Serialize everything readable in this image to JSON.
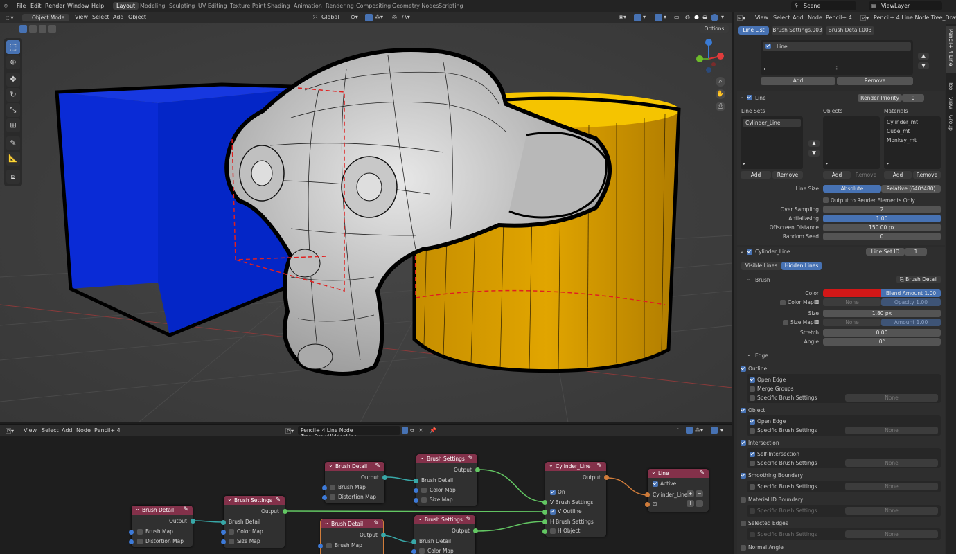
{
  "top_menu": [
    "File",
    "Edit",
    "Render",
    "Window",
    "Help"
  ],
  "workspaces": [
    "Layout",
    "Modeling",
    "Sculpting",
    "UV Editing",
    "Texture Paint",
    "Shading",
    "Animation",
    "Rendering",
    "Compositing",
    "Geometry Nodes",
    "Scripting"
  ],
  "scene": "Scene",
  "view_layer": "ViewLayer",
  "viewport": {
    "mode": "Object Mode",
    "menus": [
      "View",
      "Select",
      "Add",
      "Object"
    ],
    "transform": "Global",
    "options": "Options"
  },
  "node_editor": {
    "menus": [
      "View",
      "Select",
      "Add",
      "Node",
      "Pencil+ 4"
    ],
    "tree_name": "Pencil+ 4 Line Node Tree_DrawHiddenLine",
    "nodes": {
      "bd1": {
        "title": "Brush Detail",
        "out": "Output",
        "rows": [
          "Brush Map",
          "Distortion Map"
        ]
      },
      "bd2": {
        "title": "Brush Detail",
        "out": "Output",
        "rows": [
          "Brush Map",
          "Distortion Map"
        ]
      },
      "bd3": {
        "title": "Brush Detail",
        "out": "Output",
        "rows": [
          "Brush Map"
        ]
      },
      "bs1": {
        "title": "Brush Settings",
        "out": "Output",
        "rows": [
          "Brush Detail",
          "Color Map",
          "Size Map"
        ]
      },
      "bs2": {
        "title": "Brush Settings",
        "out": "Output",
        "rows": [
          "Brush Detail",
          "Color Map",
          "Size Map"
        ]
      },
      "bs3": {
        "title": "Brush Settings",
        "out": "Output",
        "rows": [
          "Brush Detail",
          "Color Map"
        ]
      },
      "cyl": {
        "title": "Cylinder_Line",
        "out": "Output",
        "rows": [
          "On",
          "V Brush Settings",
          "V Outline",
          "H Brush Settings",
          "H Object"
        ]
      },
      "line": {
        "title": "Line",
        "active": "Active",
        "row": "Cylinder_Line"
      }
    }
  },
  "properties": {
    "header_menus": [
      "View",
      "Select",
      "Add",
      "Node",
      "Pencil+ 4"
    ],
    "tree_name": "Pencil+ 4 Line Node Tree_DrawHidd",
    "tabs": [
      "Line List",
      "Brush Settings.003",
      "Brush Detail.003"
    ],
    "line_list_item": "Line",
    "add": "Add",
    "remove": "Remove",
    "line_section": "Line",
    "render_priority_label": "Render Priority",
    "render_priority": "0",
    "line_sets_label": "Line Sets",
    "objects_label": "Objects",
    "materials_label": "Materials",
    "line_set_item": "Cylinder_Line",
    "materials": [
      "Cylinder_mt",
      "Cube_mt",
      "Monkey_mt"
    ],
    "line_size_label": "Line Size",
    "line_size_abs": "Absolute",
    "line_size_rel": "Relative (640*480)",
    "output_render_elements": "Output to Render Elements Only",
    "over_sampling_label": "Over Sampling",
    "over_sampling": "2",
    "antialiasing_label": "Antialiasing",
    "antialiasing": "1.00",
    "offscreen_label": "Offscreen Distance",
    "offscreen": "150.00 px",
    "random_seed_label": "Random Seed",
    "random_seed": "0",
    "lineset_name": "Cylinder_Line",
    "lineset_id_label": "Line Set ID",
    "lineset_id": "1",
    "visible_lines": "Visible Lines",
    "hidden_lines": "Hidden Lines",
    "brush_label": "Brush",
    "brush_detail_btn": "Brush Detail",
    "color_label": "Color",
    "color_value": "#d21717",
    "blend_amount_label": "Blend Amount",
    "blend_amount": "1.00",
    "color_map_label": "Color Map",
    "none": "None",
    "opacity_label": "Opacity",
    "opacity": "1.00",
    "size_label": "Size",
    "size": "1.80 px",
    "size_map_label": "Size Map",
    "amount_label": "Amount",
    "amount": "1.00",
    "stretch_label": "Stretch",
    "stretch": "0.00",
    "angle_label": "Angle",
    "angle": "0°",
    "edge_label": "Edge",
    "outline": "Outline",
    "open_edge": "Open Edge",
    "merge_groups": "Merge Groups",
    "specific_brush": "Specific Brush Settings",
    "object": "Object",
    "intersection": "Intersection",
    "self_intersection": "Self-Intersection",
    "smoothing_boundary": "Smoothing Boundary",
    "material_id_boundary": "Material ID Boundary",
    "selected_edges": "Selected Edges",
    "normal_angle": "Normal Angle",
    "side_tabs": [
      "Pencil+ 4 Line",
      "Tool",
      "View",
      "Group"
    ]
  },
  "colors": {
    "accent": "#4772b3",
    "node_header": "#83314a",
    "cube": "#0a2bd6",
    "cylinder": "#d9a100"
  }
}
